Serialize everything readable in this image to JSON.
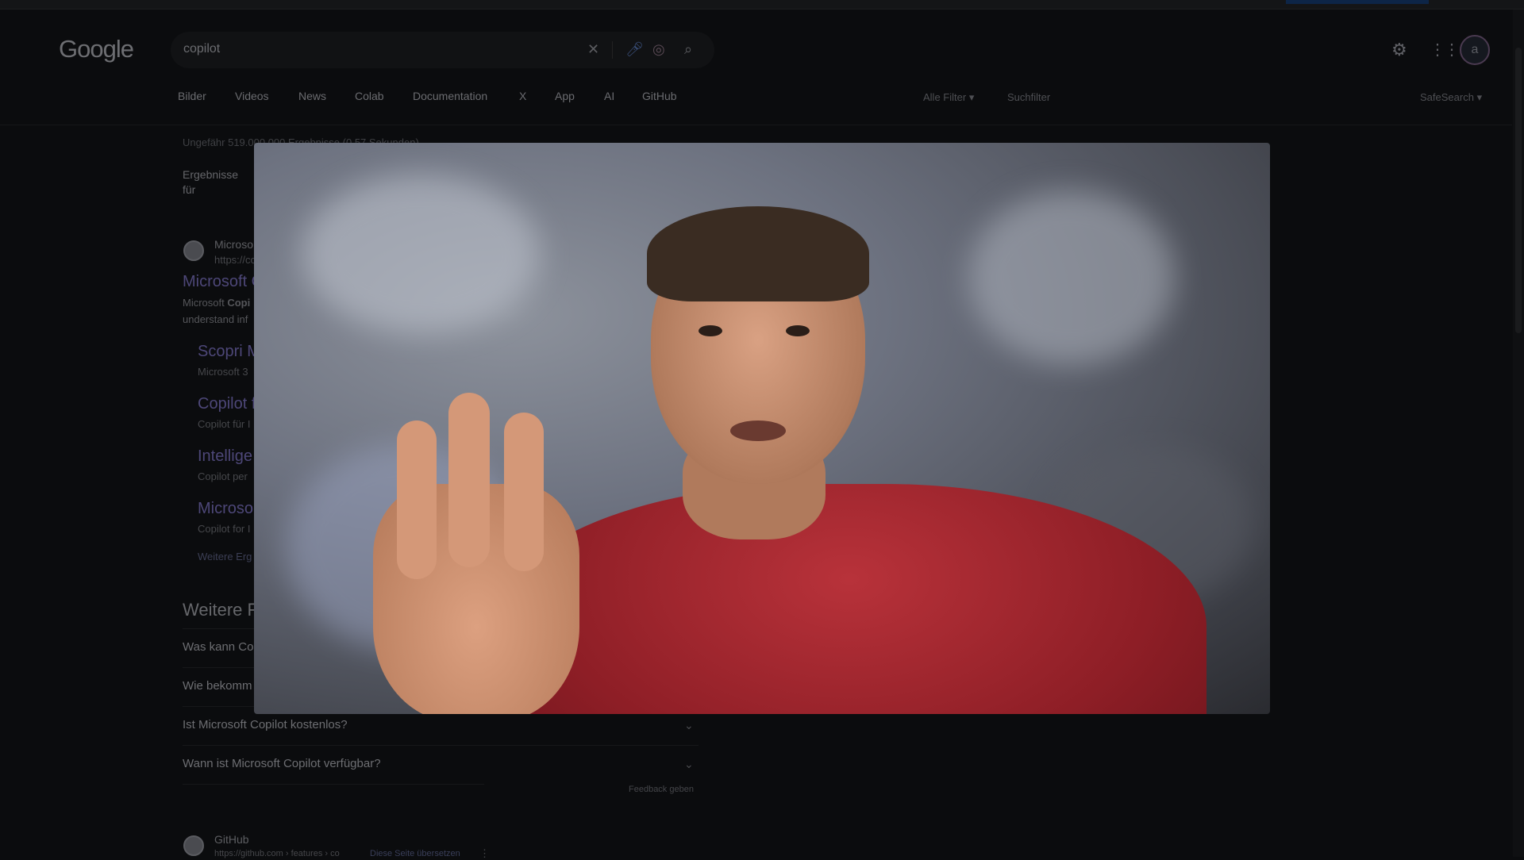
{
  "header": {
    "logo": "Google",
    "search_value": "copilot",
    "avatar_letter": "a"
  },
  "tabs": [
    "Bilder",
    "Videos",
    "News",
    "Colab",
    "Documentation",
    "X",
    "App",
    "AI",
    "GitHub"
  ],
  "filters": {
    "all_filters": "Alle Filter",
    "search_filter": "Suchfilter",
    "safesearch": "SafeSearch"
  },
  "results": {
    "stats": "Ungefähr 519.000.000 Ergebnisse (0,57 Sekunden)",
    "results_for": "Ergebnisse für",
    "first": {
      "site": "Microso",
      "url": "https://co",
      "title": "Microsoft C",
      "snippet_1_pre": "Microsoft ",
      "snippet_1_bold": "Copi",
      "snippet_2": "understand inf",
      "sitelinks": [
        {
          "title": "Scopri M",
          "desc": "Microsoft 3"
        },
        {
          "title": "Copilot f",
          "desc": "Copilot für I"
        },
        {
          "title": "Intellige",
          "desc": "Copilot per"
        },
        {
          "title": "Microso",
          "desc": "Copilot for I"
        }
      ],
      "more": "Weitere Erg"
    },
    "paa_title": "Weitere F",
    "questions": [
      "Was kann Co",
      "Wie bekomm",
      "Ist Microsoft Copilot kostenlos?",
      "Wann ist Microsoft Copilot verfügbar?"
    ],
    "feedback": "Feedback geben",
    "github": {
      "site": "GitHub",
      "url": "https://github.com › features › co",
      "translate": "Diese Seite übersetzen"
    }
  }
}
